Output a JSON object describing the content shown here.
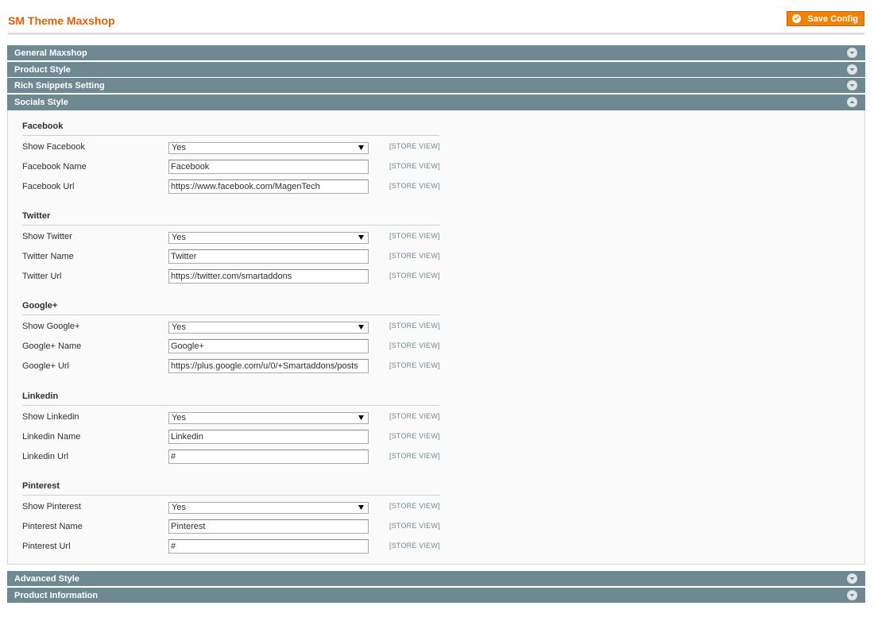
{
  "header": {
    "title": "SM Theme Maxshop",
    "save_label": "Save Config"
  },
  "sections_top": [
    {
      "label": "General Maxshop",
      "state": "collapsed"
    },
    {
      "label": "Product Style",
      "state": "collapsed"
    },
    {
      "label": "Rich Snippets Setting",
      "state": "collapsed"
    },
    {
      "label": "Socials Style",
      "state": "expanded"
    }
  ],
  "scope_label": "[STORE VIEW]",
  "groups": [
    {
      "title": "Facebook",
      "rows": [
        {
          "label": "Show Facebook",
          "type": "select",
          "value": "Yes"
        },
        {
          "label": "Facebook Name",
          "type": "text",
          "value": "Facebook"
        },
        {
          "label": "Facebook Url",
          "type": "text",
          "value": "https://www.facebook.com/MagenTech"
        }
      ]
    },
    {
      "title": "Twitter",
      "rows": [
        {
          "label": "Show Twitter",
          "type": "select",
          "value": "Yes"
        },
        {
          "label": "Twitter Name",
          "type": "text",
          "value": "Twitter"
        },
        {
          "label": "Twitter Url",
          "type": "text",
          "value": "https://twitter.com/smartaddons"
        }
      ]
    },
    {
      "title": "Google+",
      "rows": [
        {
          "label": "Show Google+",
          "type": "select",
          "value": "Yes"
        },
        {
          "label": "Google+ Name",
          "type": "text",
          "value": "Google+"
        },
        {
          "label": "Google+ Url",
          "type": "text",
          "value": "https://plus.google.com/u/0/+Smartaddons/posts"
        }
      ]
    },
    {
      "title": "Linkedin",
      "rows": [
        {
          "label": "Show Linkedin",
          "type": "select",
          "value": "Yes"
        },
        {
          "label": "Linkedin Name",
          "type": "text",
          "value": "Linkedin"
        },
        {
          "label": "Linkedin Url",
          "type": "text",
          "value": "#"
        }
      ]
    },
    {
      "title": "Pinterest",
      "rows": [
        {
          "label": "Show Pinterest",
          "type": "select",
          "value": "Yes"
        },
        {
          "label": "Pinterest Name",
          "type": "text",
          "value": "Pinterest"
        },
        {
          "label": "Pinterest Url",
          "type": "text",
          "value": "#"
        }
      ]
    }
  ],
  "sections_bottom": [
    {
      "label": "Advanced Style",
      "state": "collapsed"
    },
    {
      "label": "Product Information",
      "state": "collapsed"
    }
  ],
  "icons": {
    "save": "check-circle-icon",
    "collapsed": "chevron-down-circle-icon",
    "expanded": "chevron-up-circle-icon"
  },
  "colors": {
    "accent": "#eb5e00",
    "button": "#f18200",
    "section_bar": "#6f8992",
    "scope_text": "#6f8992"
  }
}
